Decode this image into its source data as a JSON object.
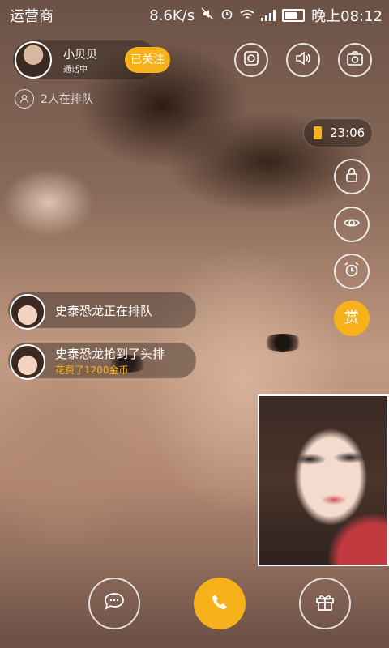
{
  "status_bar": {
    "carrier": "运营商",
    "speed": "8.6K/s",
    "time": "晚上08:12"
  },
  "host": {
    "name": "小贝贝",
    "status": "通话中",
    "follow_label": "已关注"
  },
  "queue": {
    "text": "2人在排队"
  },
  "timer": {
    "value": "23:06"
  },
  "reward": {
    "label": "赏"
  },
  "messages": [
    {
      "text": "史泰恐龙正在排队"
    },
    {
      "text": "史泰恐龙抢到了头排",
      "sub": "花费了1200金币"
    }
  ],
  "icons": {
    "beauty": "beauty-filter-icon",
    "speaker": "speaker-icon",
    "camera": "camera-switch-icon",
    "lock": "lock-icon",
    "eye": "eye-icon",
    "alarm": "alarm-icon",
    "chat": "chat-bubble-icon",
    "call": "phone-hangup-icon",
    "gift": "gift-icon"
  },
  "colors": {
    "accent": "#f7b21b"
  }
}
